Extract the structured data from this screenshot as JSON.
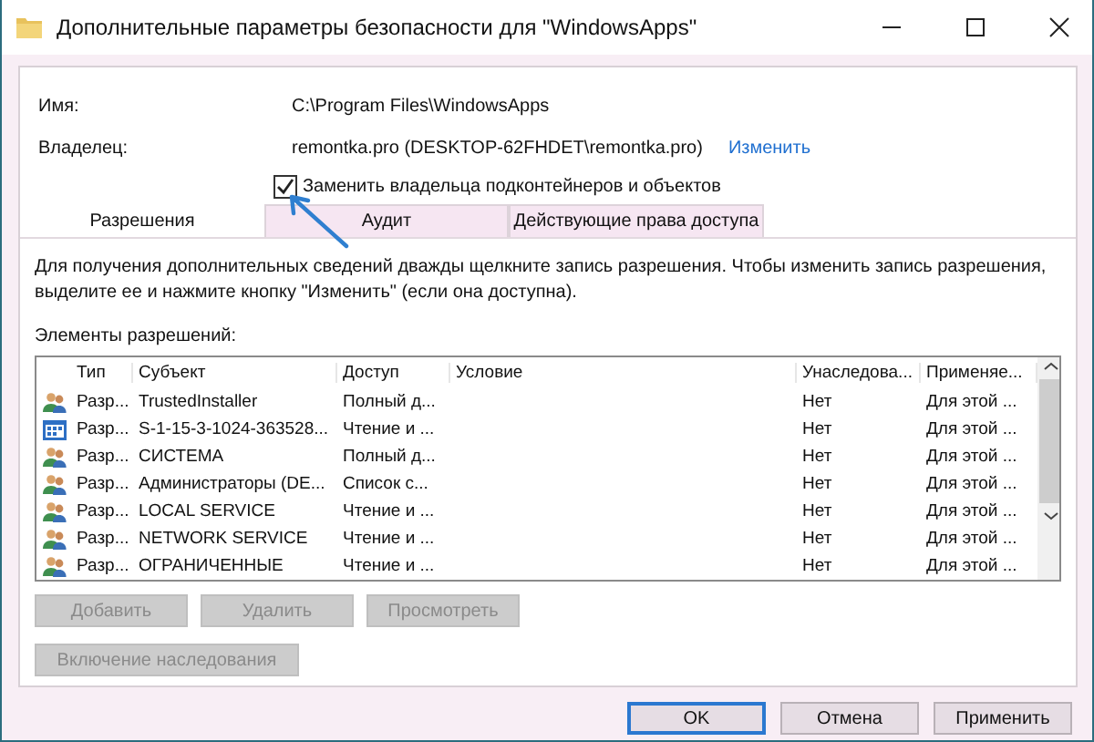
{
  "window": {
    "title": "Дополнительные параметры безопасности  для \"WindowsApps\""
  },
  "name": {
    "label": "Имя:",
    "value": "C:\\Program Files\\WindowsApps"
  },
  "owner": {
    "label": "Владелец:",
    "value": "remontka.pro (DESKTOP-62FHDET\\remontka.pro)",
    "link": "Изменить"
  },
  "replace_owner": {
    "label": "Заменить владельца подконтейнеров и объектов",
    "checked": true
  },
  "tabs": [
    {
      "label": "Разрешения",
      "selected": true
    },
    {
      "label": "Аудит",
      "selected": false
    },
    {
      "label": "Действующие права доступа",
      "selected": false
    }
  ],
  "description": "Для получения дополнительных сведений дважды щелкните запись разрешения. Чтобы изменить запись разрешения, выделите ее и нажмите кнопку \"Изменить\" (если она доступна).",
  "list_label": "Элементы разрешений:",
  "table": {
    "columns": [
      "Тип",
      "Субъект",
      "Доступ",
      "Условие",
      "Унаследова...",
      "Применяе..."
    ],
    "rows": [
      {
        "kind": "group",
        "cells": [
          "Разр...",
          "TrustedInstaller",
          "Полный д...",
          "",
          "Нет",
          "Для этой ..."
        ]
      },
      {
        "kind": "app",
        "cells": [
          "Разр...",
          "S-1-15-3-1024-363528...",
          "Чтение и ...",
          "",
          "Нет",
          "Для этой ..."
        ]
      },
      {
        "kind": "group",
        "cells": [
          "Разр...",
          "СИСТЕМА",
          "Полный д...",
          "",
          "Нет",
          "Для этой ..."
        ]
      },
      {
        "kind": "group",
        "cells": [
          "Разр...",
          "Администраторы (DE...",
          "Список с...",
          "",
          "Нет",
          "Для этой ..."
        ]
      },
      {
        "kind": "group",
        "cells": [
          "Разр...",
          "LOCAL SERVICE",
          "Чтение и ...",
          "",
          "Нет",
          "Для этой ..."
        ]
      },
      {
        "kind": "group",
        "cells": [
          "Разр...",
          "NETWORK SERVICE",
          "Чтение и ...",
          "",
          "Нет",
          "Для этой ..."
        ]
      },
      {
        "kind": "group",
        "cells": [
          "Разр...",
          "ОГРАНИЧЕННЫЕ",
          "Чтение и ...",
          "",
          "Нет",
          "Для этой ..."
        ]
      }
    ]
  },
  "row_buttons": [
    {
      "label": "Добавить",
      "disabled": true
    },
    {
      "label": "Удалить",
      "disabled": true
    },
    {
      "label": "Просмотреть",
      "disabled": true
    }
  ],
  "inheritance_button": {
    "label": "Включение наследования",
    "disabled": true
  },
  "footer_buttons": [
    {
      "label": "OK",
      "selected": true
    },
    {
      "label": "Отмена",
      "selected": false
    },
    {
      "label": "Применить",
      "selected": false
    }
  ]
}
